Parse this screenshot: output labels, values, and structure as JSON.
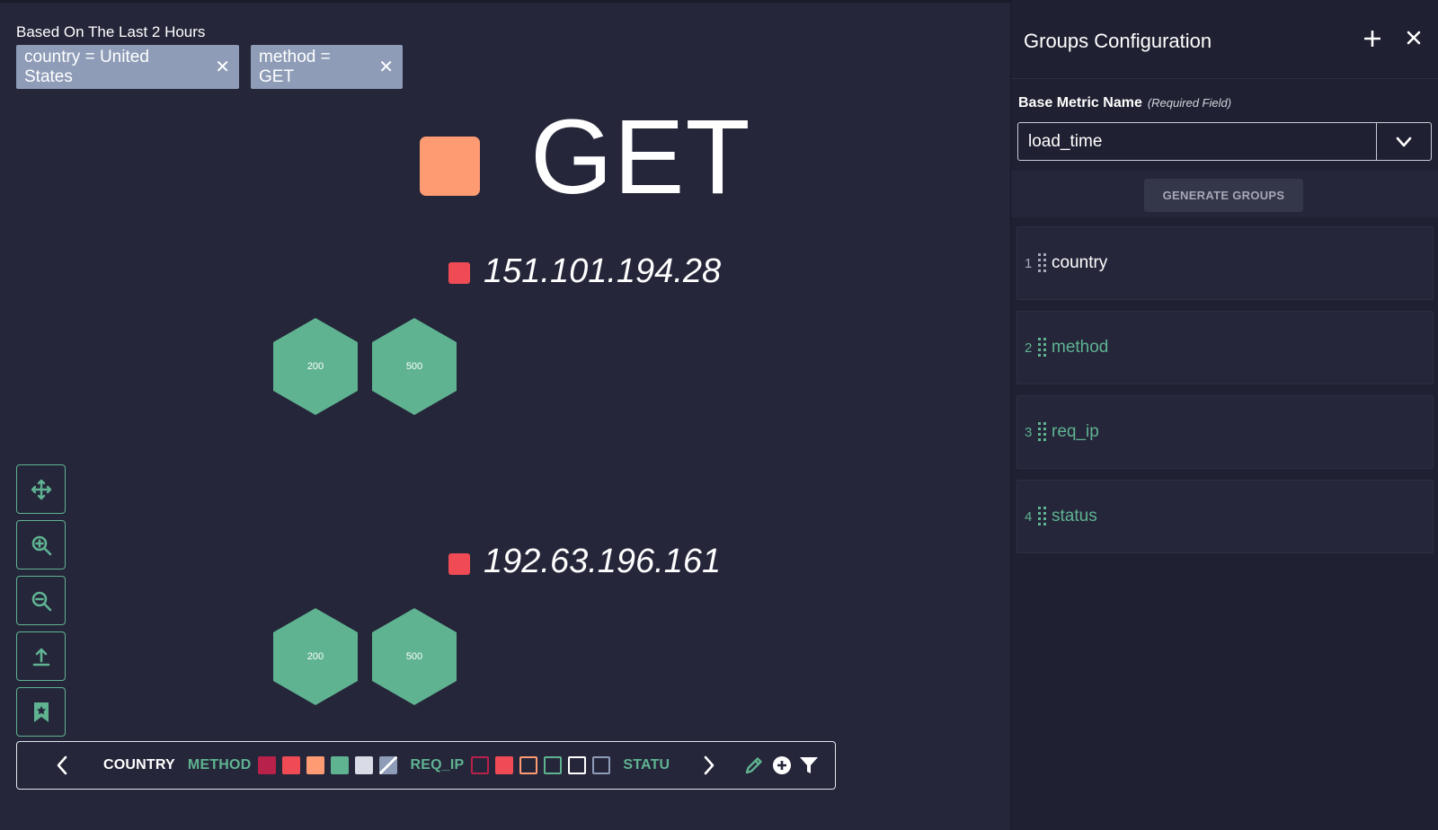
{
  "timeframe": "Based On The Last 2 Hours",
  "filters": [
    {
      "key": "country",
      "op": "=",
      "value": "United States",
      "text": "country = United States"
    },
    {
      "key": "method",
      "op": "=",
      "value": "GET",
      "text": "method = GET"
    }
  ],
  "group": {
    "title": "GET",
    "color": "#ff9b73"
  },
  "subgroups": [
    {
      "ip": "151.101.194.28",
      "color": "#f04b55",
      "statuses": [
        "200",
        "500"
      ]
    },
    {
      "ip": "192.63.196.161",
      "color": "#f04b55",
      "statuses": [
        "200",
        "500"
      ]
    }
  ],
  "tools": [
    "move-icon",
    "zoom-in-icon",
    "zoom-out-icon",
    "upload-icon",
    "bookmark-icon"
  ],
  "legend": {
    "country_label": "COUNTRY",
    "method_label": "METHOD",
    "method_swatches": [
      "#b7214a",
      "#f04b55",
      "#ff9b73",
      "#5fb391",
      "#d9dbe6",
      "#8e9cb7"
    ],
    "req_ip_label": "REQ_IP",
    "req_ip_swatches": [
      "#b7214a",
      "#f04b55",
      "#ff9b73",
      "#5fb391",
      "#ffffff",
      "#8e9cb7"
    ],
    "status_label": "STATU"
  },
  "panel": {
    "title": "Groups Configuration",
    "base_metric_label": "Base Metric Name",
    "required_note": "(Required Field)",
    "base_metric_value": "load_time",
    "generate_label": "GENERATE GROUPS",
    "groups": [
      {
        "num": "1",
        "name": "country",
        "color": "#ffffff"
      },
      {
        "num": "2",
        "name": "method",
        "color": "#5fb391"
      },
      {
        "num": "3",
        "name": "req_ip",
        "color": "#5fb391"
      },
      {
        "num": "4",
        "name": "status",
        "color": "#5fb391"
      }
    ]
  },
  "colors": {
    "accent": "#5fb391",
    "bg": "#25263a",
    "panel": "#1f2031",
    "chip": "#8e9cb7"
  }
}
